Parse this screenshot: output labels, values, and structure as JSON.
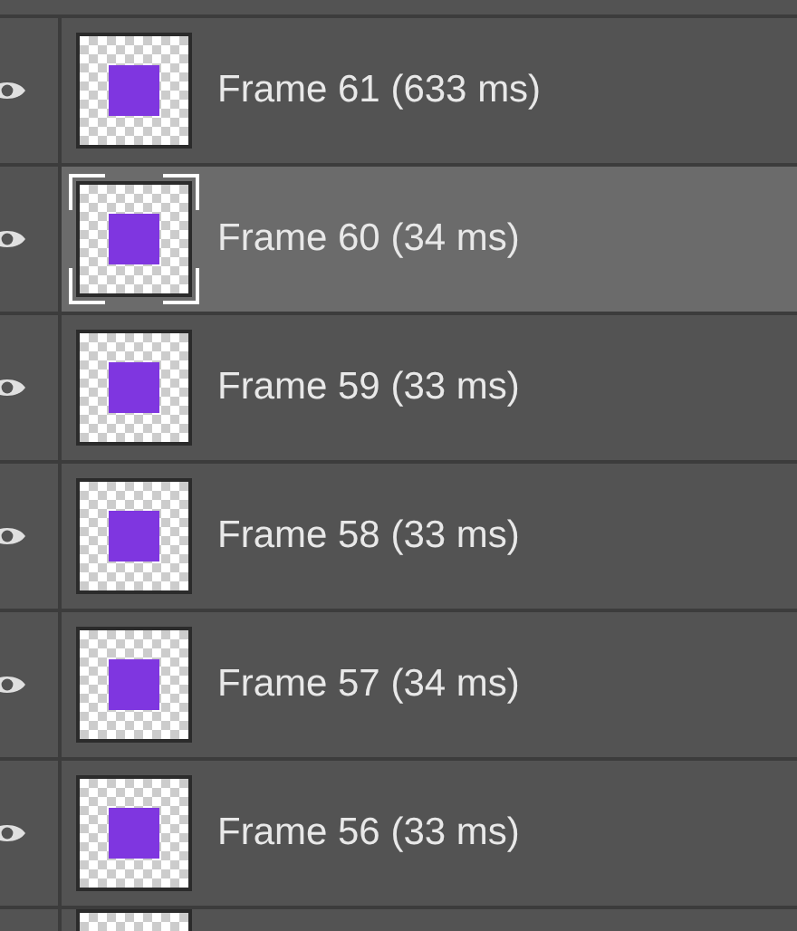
{
  "frames": [
    {
      "kind": "frame",
      "label": "Frame 61 (633 ms)",
      "visible": true,
      "selected": false
    },
    {
      "kind": "frame",
      "label": "Frame 60 (34 ms)",
      "visible": true,
      "selected": true
    },
    {
      "kind": "frame",
      "label": "Frame 59 (33 ms)",
      "visible": true,
      "selected": false
    },
    {
      "kind": "frame",
      "label": "Frame 58 (33 ms)",
      "visible": true,
      "selected": false
    },
    {
      "kind": "frame",
      "label": "Frame 57 (34 ms)",
      "visible": true,
      "selected": false
    },
    {
      "kind": "frame",
      "label": "Frame 56 (33 ms)",
      "visible": true,
      "selected": false
    },
    {
      "kind": "cut"
    }
  ]
}
